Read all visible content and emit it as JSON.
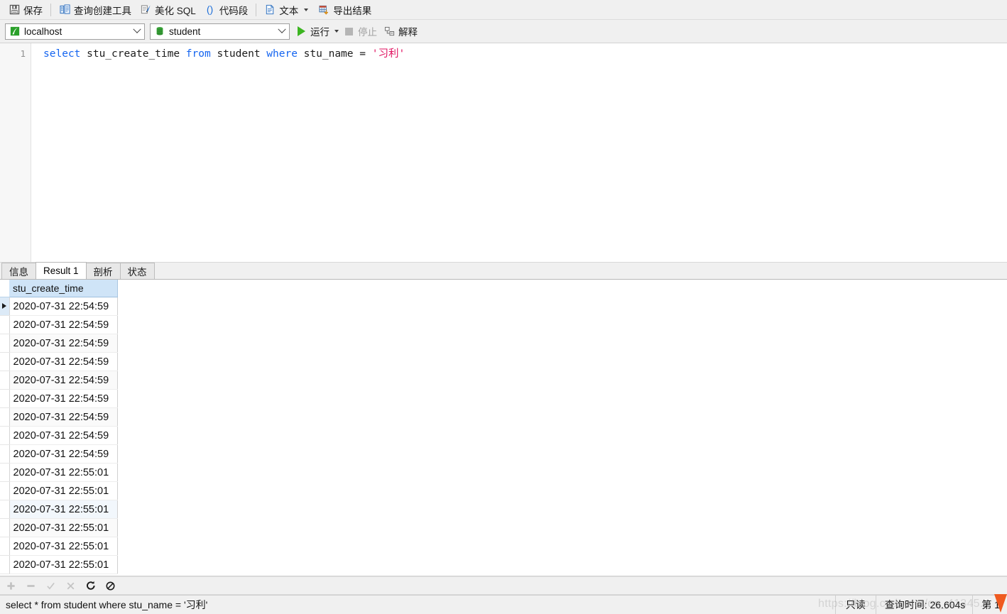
{
  "toolbar_main": {
    "items": [
      {
        "label": "保存",
        "icon": "save-floppy-icon"
      },
      {
        "label": "查询创建工具",
        "icon": "query-builder-icon"
      },
      {
        "label": "美化 SQL",
        "icon": "beautify-sql-icon"
      },
      {
        "label": "代码段",
        "icon": "code-snippet-icon"
      },
      {
        "label": "文本",
        "icon": "text-document-icon"
      },
      {
        "label": "导出结果",
        "icon": "export-result-icon"
      }
    ]
  },
  "toolbar_connection": {
    "host": {
      "value": "localhost",
      "icon": "connection-icon"
    },
    "database": {
      "value": "student",
      "icon": "database-icon"
    },
    "run_label": "运行",
    "stop_label": "停止",
    "explain_label": "解释"
  },
  "editor": {
    "line_number": "1",
    "tokens": [
      {
        "text": "select",
        "type": "keyword"
      },
      {
        "text": " stu_create_time ",
        "type": "plain"
      },
      {
        "text": "from",
        "type": "keyword"
      },
      {
        "text": " student ",
        "type": "plain"
      },
      {
        "text": "where",
        "type": "keyword"
      },
      {
        "text": " stu_name = ",
        "type": "plain"
      },
      {
        "text": "'习利'",
        "type": "string"
      }
    ]
  },
  "result_tabs": [
    {
      "label": "信息",
      "active": false
    },
    {
      "label": "Result 1",
      "active": true
    },
    {
      "label": "剖析",
      "active": false
    },
    {
      "label": "状态",
      "active": false
    }
  ],
  "result_grid": {
    "columns": [
      "stu_create_time"
    ],
    "rows": [
      "2020-07-31 22:54:59",
      "2020-07-31 22:54:59",
      "2020-07-31 22:54:59",
      "2020-07-31 22:54:59",
      "2020-07-31 22:54:59",
      "2020-07-31 22:54:59",
      "2020-07-31 22:54:59",
      "2020-07-31 22:54:59",
      "2020-07-31 22:54:59",
      "2020-07-31 22:55:01",
      "2020-07-31 22:55:01",
      "2020-07-31 22:55:01",
      "2020-07-31 22:55:01",
      "2020-07-31 22:55:01",
      "2020-07-31 22:55:01"
    ],
    "selected_row_index": 0
  },
  "grid_nav": {
    "buttons": [
      {
        "icon": "add-row-icon",
        "enabled": false
      },
      {
        "icon": "remove-row-icon",
        "enabled": false
      },
      {
        "icon": "confirm-check-icon",
        "enabled": false
      },
      {
        "icon": "cancel-cross-icon",
        "enabled": false
      },
      {
        "icon": "refresh-icon",
        "enabled": true
      },
      {
        "icon": "stop-prohibited-icon",
        "enabled": true
      }
    ]
  },
  "status_bar": {
    "query_text": "select * from student where stu_name = '习利'",
    "read_only": "只读",
    "query_time": "查询时间: 26.604s",
    "page": "第 1",
    "watermark": "https://blog.csdn.net/qq_41345..."
  },
  "colors": {
    "keyword": "#1565f0",
    "string": "#e0115f",
    "header_bg": "#cfe4f7",
    "run_green": "#3cb521",
    "chrome": "#f0f0f0"
  }
}
